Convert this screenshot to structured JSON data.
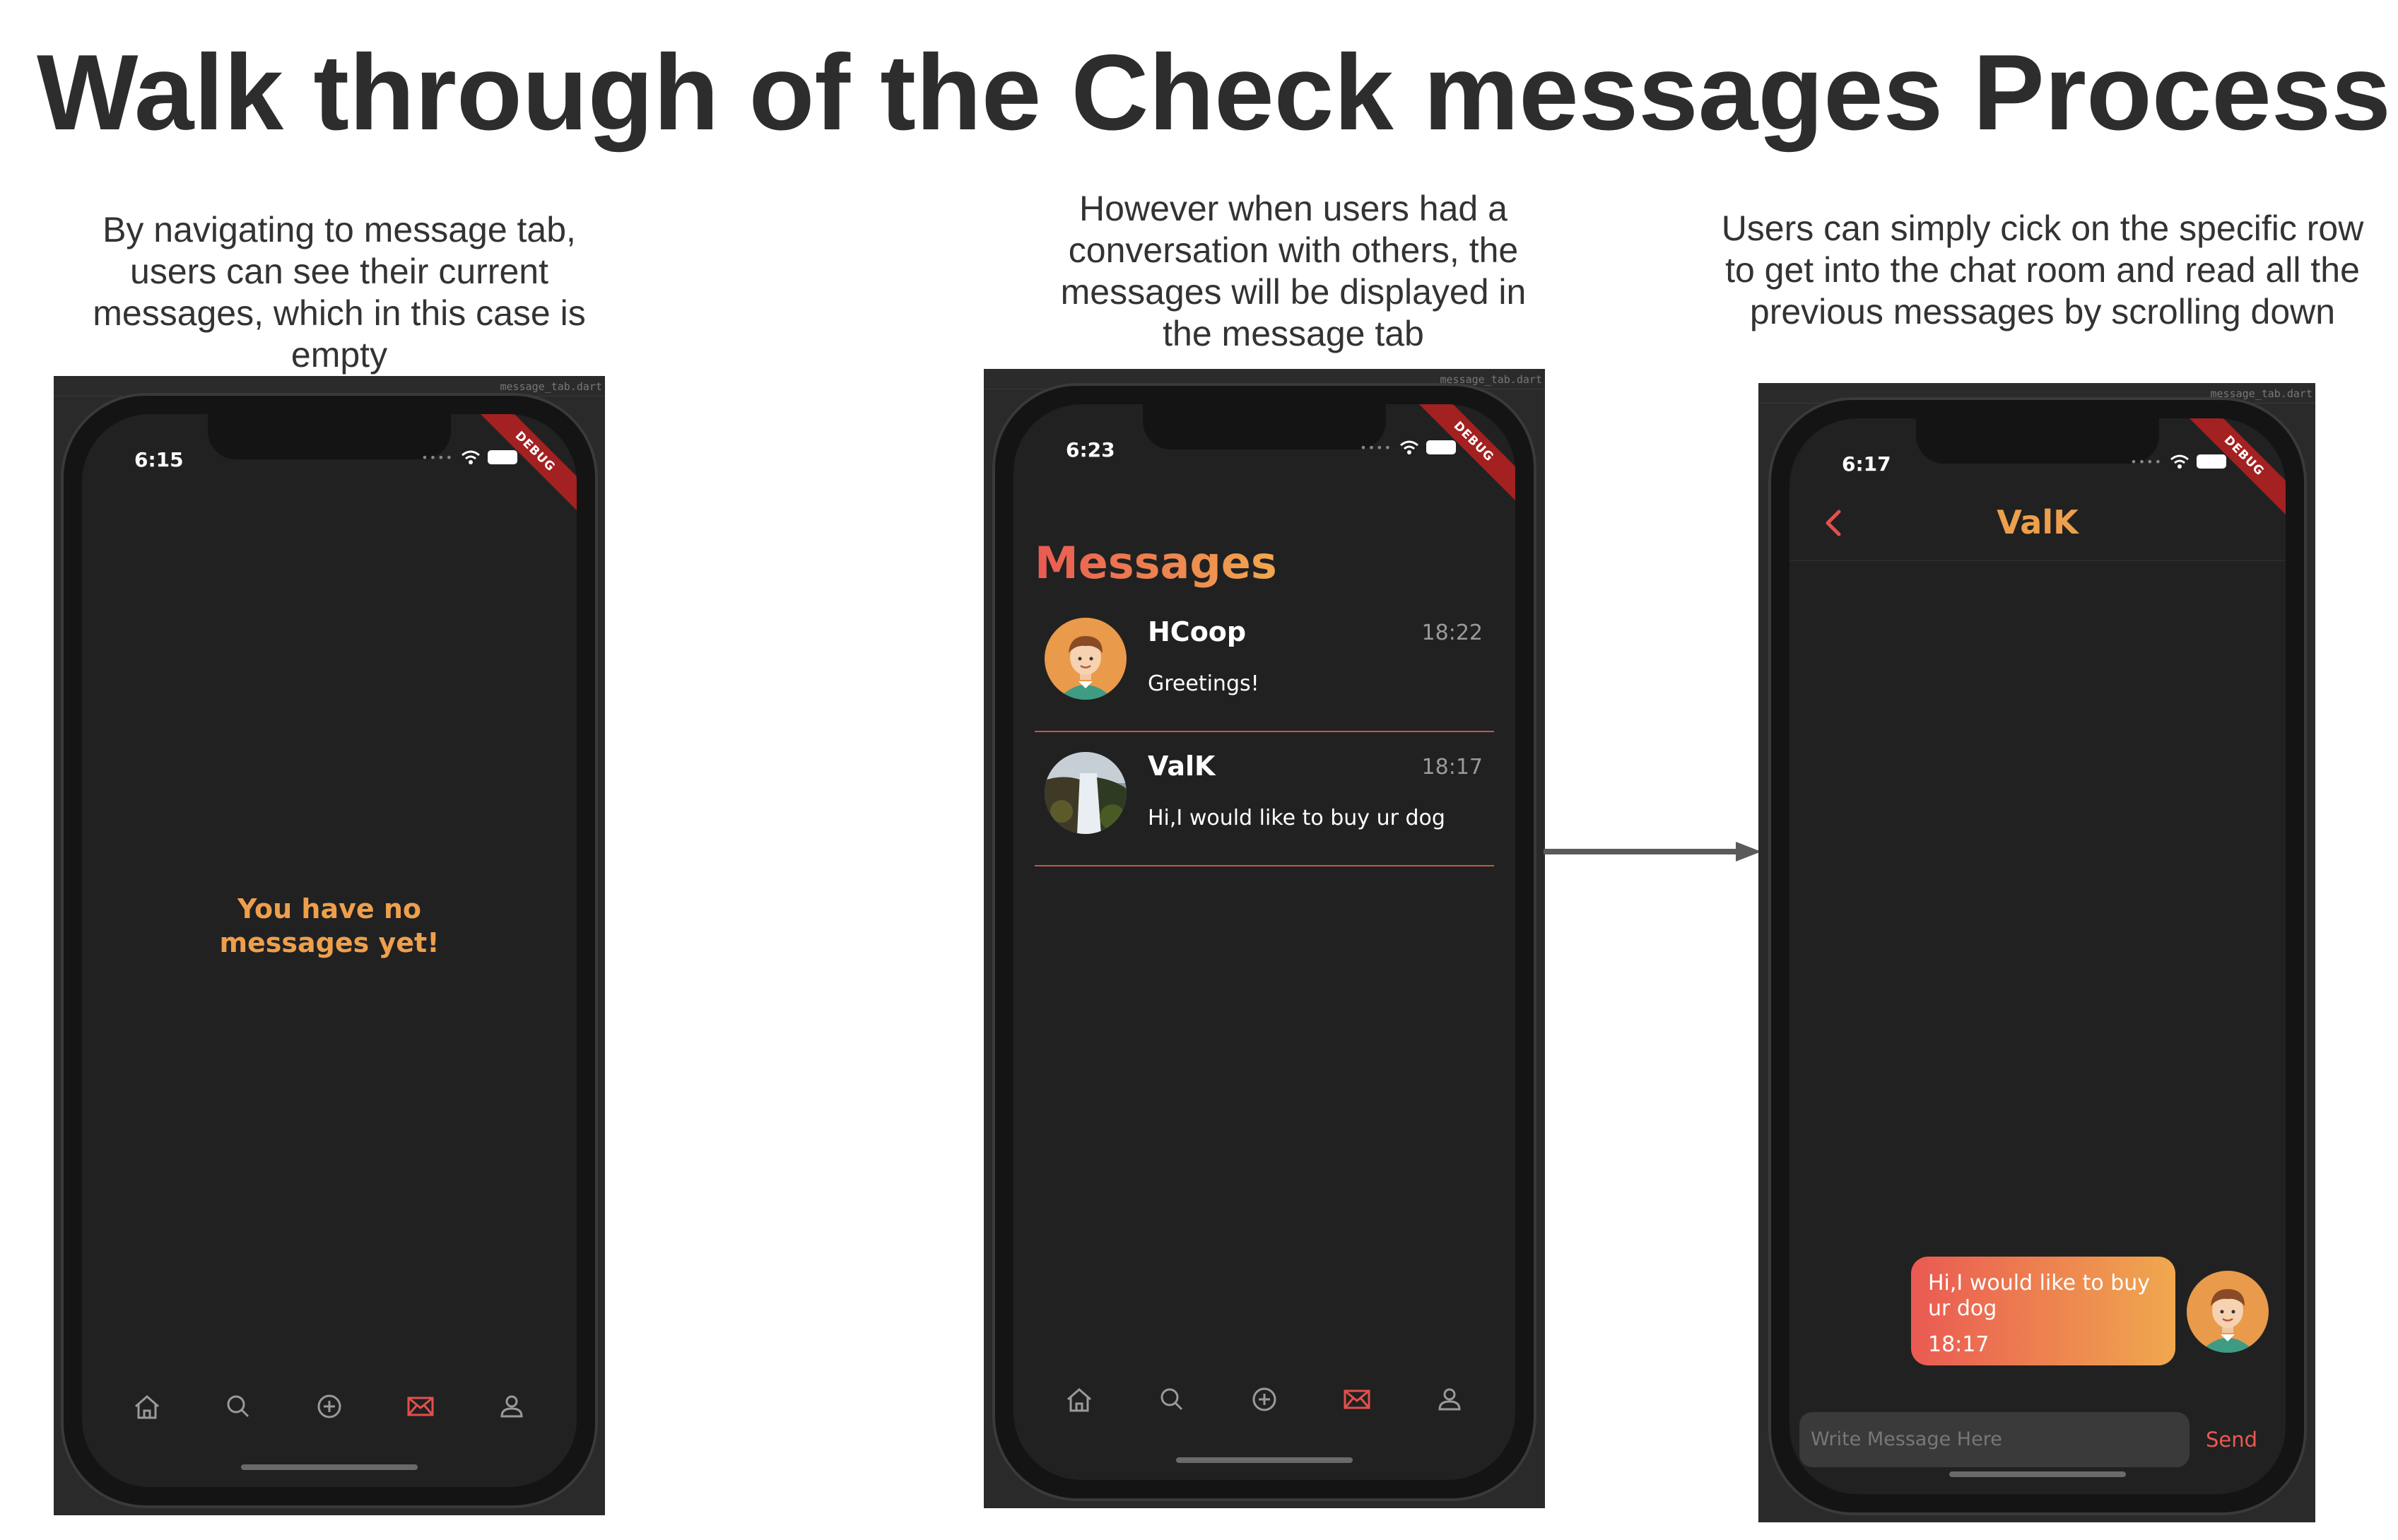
{
  "title": "Walk through of the Check messages Process",
  "captions": {
    "step1": "By navigating to message tab, users can see their current messages, which in this case is empty",
    "step2": "However when users had a conversation with others, the messages will be displayed in the message tab",
    "step3": "Users can simply cick on the specific row to get into the chat room and read all the previous messages by scrolling down"
  },
  "ide_tabs": {
    "phone1": "message_tab.dart",
    "phone2": "message_tab.dart",
    "phone3": "message_tab.dart"
  },
  "debug_label": "DEBUG",
  "colors": {
    "accent_red": "#ea5a52",
    "accent_orange": "#f0a84e",
    "background_dark": "#212121",
    "nav_active": "#e2504c",
    "nav_inactive": "#9a9a9a"
  },
  "nav_icons": [
    "home-icon",
    "search-icon",
    "add-circle-icon",
    "mail-icon",
    "profile-icon"
  ],
  "nav_active_index": 3,
  "phone1": {
    "time": "6:15",
    "empty_state": "You have no messages yet!"
  },
  "phone2": {
    "time": "6:23",
    "heading": "Messages",
    "conversations": [
      {
        "name": "HCoop",
        "time": "18:22",
        "preview": "Greetings!",
        "avatar": "cartoon-boy-avatar"
      },
      {
        "name": "ValK",
        "time": "18:17",
        "preview": "Hi,I would like to buy ur dog",
        "avatar": "waterfall-photo-avatar"
      }
    ]
  },
  "phone3": {
    "time": "6:17",
    "chat_title": "ValK",
    "message": {
      "text": "Hi,I would like to buy ur dog",
      "time": "18:17"
    },
    "input_placeholder": "Write Message Here",
    "send_label": "Send"
  }
}
